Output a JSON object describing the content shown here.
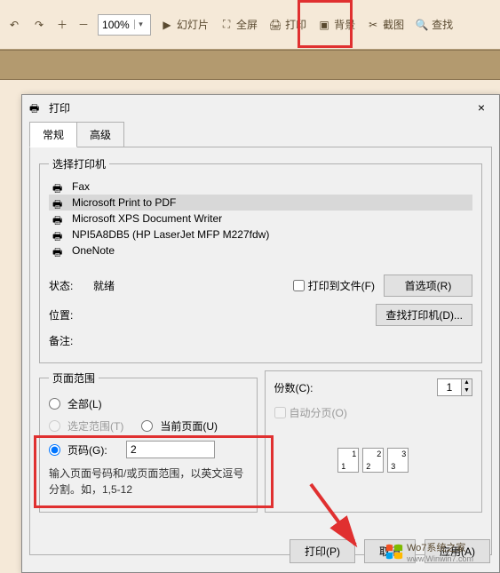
{
  "toolbar": {
    "zoom": "100%",
    "slideshow": "幻灯片",
    "fullscreen": "全屏",
    "print": "打印",
    "background": "背景",
    "screenshot": "截图",
    "search": "查找"
  },
  "dialog": {
    "title": "打印",
    "close": "×",
    "tabs": {
      "general": "常规",
      "advanced": "高级"
    },
    "printer_group": "选择打印机",
    "printers": {
      "fax": "Fax",
      "pdf": "Microsoft Print to PDF",
      "xps": "Microsoft XPS Document Writer",
      "hp": "NPI5A8DB5 (HP LaserJet MFP M227fdw)",
      "onenote": "OneNote"
    },
    "status_label": "状态:",
    "status_value": "就绪",
    "location_label": "位置:",
    "comment_label": "备注:",
    "print_to_file": "打印到文件(F)",
    "preferences": "首选项(R)",
    "find_printer": "查找打印机(D)...",
    "range_group": "页面范围",
    "all": "全部(L)",
    "selection": "选定范围(T)",
    "current": "当前页面(U)",
    "pages": "页码(G):",
    "pages_value": "2",
    "hint": "输入页面号码和/或页面范围，以英文逗号分割。如，1,5-12",
    "copies_label": "份数(C):",
    "copies_value": "1",
    "collate": "自动分页(O)",
    "stack1a": "1",
    "stack1b": "1",
    "stack2a": "2",
    "stack2b": "2",
    "stack3a": "3",
    "stack3b": "3",
    "print_btn": "打印(P)",
    "cancel_btn": "取消",
    "apply_btn": "应用(A)"
  },
  "watermark": {
    "line1": "Wo7系统之家",
    "line2": "www.Winwin7.com"
  }
}
